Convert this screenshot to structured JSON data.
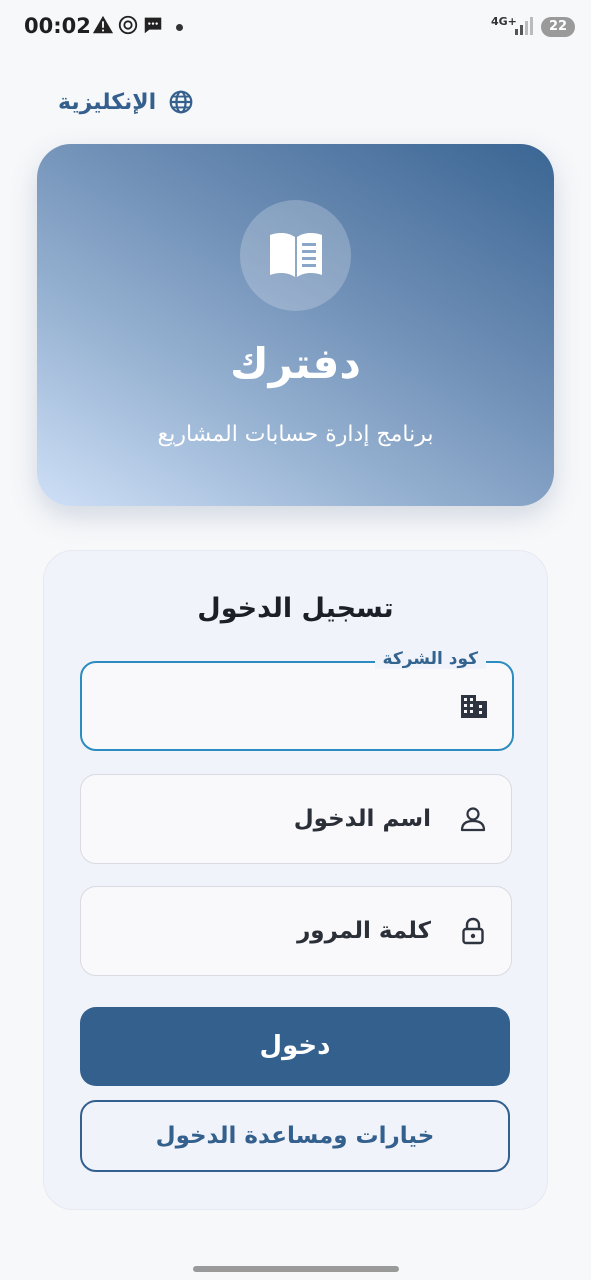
{
  "status_bar": {
    "time": "00:02",
    "network": "4G+",
    "battery": "22"
  },
  "language": {
    "label": "الإنكليزية",
    "icon": "globe-icon"
  },
  "hero": {
    "title": "دفترك",
    "subtitle": "برنامج إدارة حسابات المشاريع",
    "icon": "open-book-icon"
  },
  "form": {
    "title": "تسجيل الدخول",
    "company_code": {
      "label": "كود الشركة",
      "value": "",
      "icon": "building-icon"
    },
    "username": {
      "placeholder": "اسم الدخول",
      "icon": "user-icon"
    },
    "password": {
      "placeholder": "كلمة المرور",
      "icon": "lock-icon"
    },
    "login_button": "دخول",
    "help_button": "خيارات ومساعدة الدخول"
  },
  "colors": {
    "primary": "#34608e",
    "focus": "#2b8cbf",
    "background": "#f7f8fa"
  }
}
